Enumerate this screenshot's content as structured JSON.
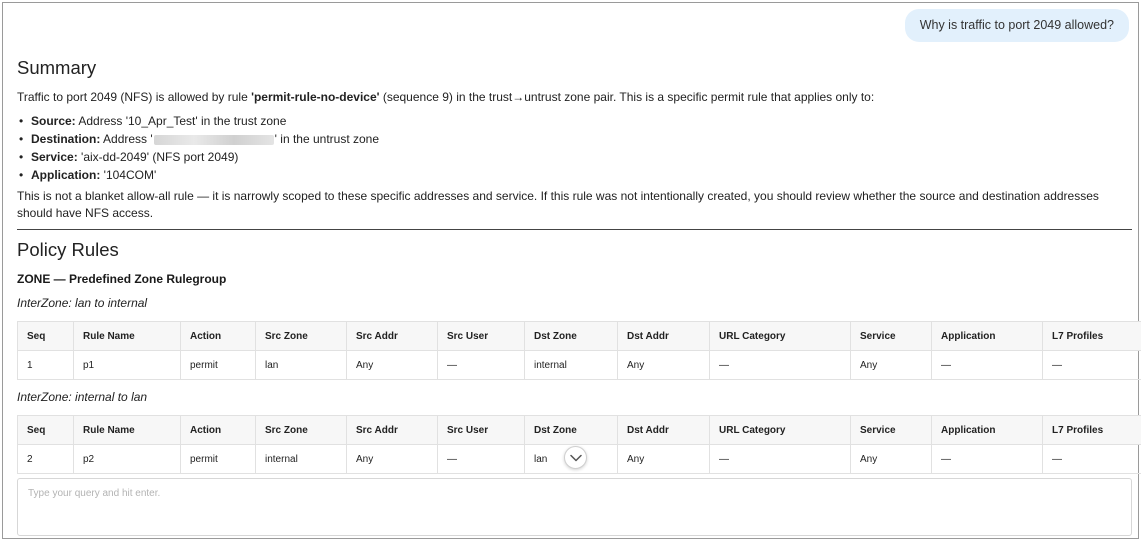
{
  "chat": {
    "user_question": "Why is traffic to port 2049 allowed?"
  },
  "summary": {
    "title": "Summary",
    "intro_pre": "Traffic to port 2049 (NFS) is allowed by rule ",
    "intro_rule": "'permit-rule-no-device'",
    "intro_post": " (sequence 9) in the trust→untrust zone pair. This is a specific permit rule that applies only to:",
    "bullets": [
      {
        "label": "Source:",
        "text": " Address '10_Apr_Test' in the trust zone"
      },
      {
        "label": "Destination:",
        "text_pre": " Address '",
        "text_post": "' in the untrust zone"
      },
      {
        "label": "Service:",
        "text": " 'aix-dd-2049' (NFS port 2049)"
      },
      {
        "label": "Application:",
        "text": " '104COM'"
      }
    ],
    "conclusion": "This is not a blanket allow-all rule — it is narrowly scoped to these specific addresses and service. If this rule was not intentionally created, you should review whether the source and destination addresses should have NFS access."
  },
  "policy": {
    "title": "Policy Rules",
    "group_title": "ZONE — Predefined Zone Rulegroup",
    "columns": [
      "Seq",
      "Rule Name",
      "Action",
      "Src Zone",
      "Src Addr",
      "Src User",
      "Dst Zone",
      "Dst Addr",
      "URL Category",
      "Service",
      "Application",
      "L7 Profiles"
    ],
    "interzones": [
      {
        "label": "InterZone: lan to internal",
        "rows": [
          [
            "1",
            "p1",
            "permit",
            "lan",
            "Any",
            "—",
            "internal",
            "Any",
            "—",
            "Any",
            "—",
            "—"
          ]
        ]
      },
      {
        "label": "InterZone: internal to lan",
        "rows": [
          [
            "2",
            "p2",
            "permit",
            "internal",
            "Any",
            "—",
            "lan",
            "Any",
            "—",
            "Any",
            "—",
            "—"
          ]
        ]
      }
    ]
  },
  "query": {
    "placeholder": "Type your query and hit enter."
  }
}
